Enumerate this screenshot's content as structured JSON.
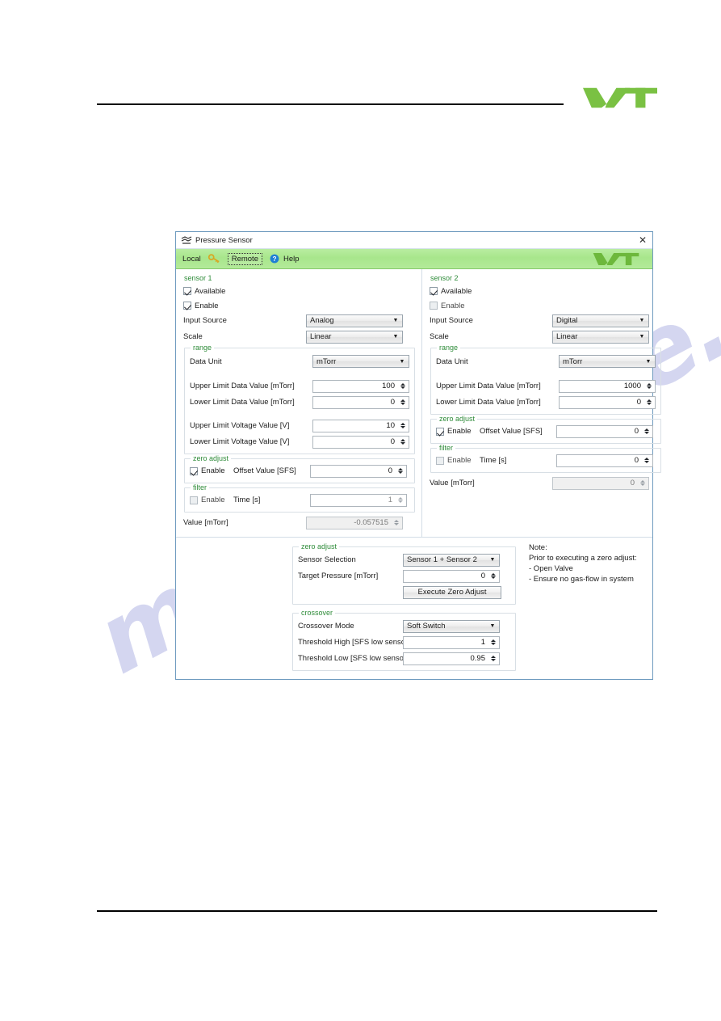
{
  "page": {
    "logo_alt": "vat-logo"
  },
  "watermark": {
    "text": "manualshive.com"
  },
  "dialog": {
    "title": "Pressure Sensor",
    "title_icon": "valve-icon",
    "close_label": "✕",
    "toolbar": {
      "local_label": "Local",
      "key_icon": "key-icon",
      "remote_label": "Remote",
      "help_icon": "help-icon",
      "help_label": "Help",
      "logo": "vat-logo"
    },
    "sensor1": {
      "legend": "sensor 1",
      "available_label": "Available",
      "available_checked": true,
      "enable_label": "Enable",
      "enable_checked": true,
      "input_source_label": "Input Source",
      "input_source_value": "Analog",
      "scale_label": "Scale",
      "scale_value": "Linear",
      "range": {
        "legend": "range",
        "data_unit_label": "Data Unit",
        "data_unit_value": "mTorr",
        "upper_data_label": "Upper Limit Data Value [mTorr]",
        "upper_data_value": "100",
        "lower_data_label": "Lower Limit Data Value [mTorr]",
        "lower_data_value": "0",
        "upper_voltage_label": "Upper Limit Voltage Value [V]",
        "upper_voltage_value": "10",
        "lower_voltage_label": "Lower Limit Voltage Value [V]",
        "lower_voltage_value": "0"
      },
      "zero_adjust": {
        "legend": "zero adjust",
        "enable_label": "Enable",
        "enable_checked": true,
        "offset_label": "Offset Value [SFS]",
        "offset_value": "0"
      },
      "filter": {
        "legend": "filter",
        "enable_label": "Enable",
        "enable_checked": false,
        "time_label": "Time [s]",
        "time_value": "1"
      },
      "value_label": "Value [mTorr]",
      "value_value": "-0.057515"
    },
    "sensor2": {
      "legend": "sensor 2",
      "available_label": "Available",
      "available_checked": true,
      "enable_label": "Enable",
      "enable_checked": false,
      "input_source_label": "Input Source",
      "input_source_value": "Digital",
      "scale_label": "Scale",
      "scale_value": "Linear",
      "range": {
        "legend": "range",
        "data_unit_label": "Data Unit",
        "data_unit_value": "mTorr",
        "upper_data_label": "Upper Limit Data Value [mTorr]",
        "upper_data_value": "1000",
        "lower_data_label": "Lower Limit Data Value [mTorr]",
        "lower_data_value": "0"
      },
      "zero_adjust": {
        "legend": "zero adjust",
        "enable_label": "Enable",
        "enable_checked": true,
        "offset_label": "Offset Value [SFS]",
        "offset_value": "0"
      },
      "filter": {
        "legend": "filter",
        "enable_label": "Enable",
        "enable_checked": false,
        "time_label": "Time [s]",
        "time_value": "0"
      },
      "value_label": "Value [mTorr]",
      "value_value": "0"
    },
    "zero_adjust_global": {
      "legend": "zero adjust",
      "sensor_selection_label": "Sensor Selection",
      "sensor_selection_value": "Sensor 1 + Sensor 2",
      "target_pressure_label": "Target Pressure [mTorr]",
      "target_pressure_value": "0",
      "execute_button": "Execute Zero Adjust"
    },
    "crossover": {
      "legend": "crossover",
      "mode_label": "Crossover Mode",
      "mode_value": "Soft Switch",
      "threshold_high_label": "Threshold High [SFS low sensor]",
      "threshold_high_value": "1",
      "threshold_low_label": "Threshold Low [SFS low sensor]",
      "threshold_low_value": "0.95"
    },
    "note": {
      "line1": "Note:",
      "line2": "Prior to executing a zero adjust:",
      "line3": "- Open Valve",
      "line4": "- Ensure no gas-flow in system"
    }
  },
  "colors": {
    "brand_green": "#7ac143",
    "toolbar_green": "#aee68f",
    "legend_green": "#2f8c3a",
    "watermark": "#cdd0ee"
  }
}
